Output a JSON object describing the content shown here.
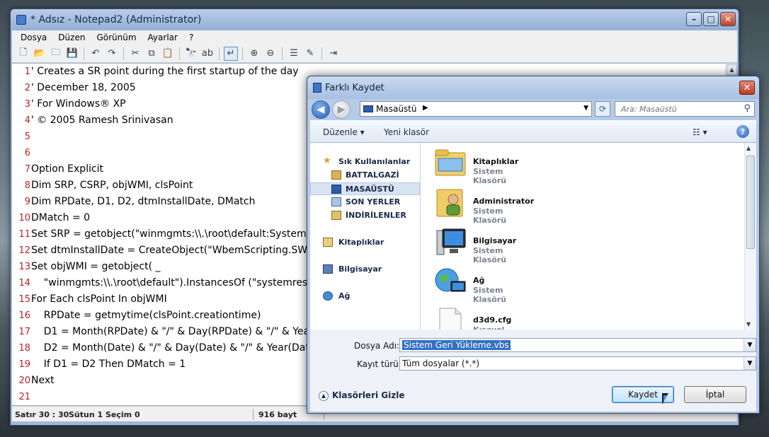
{
  "notepad": {
    "title": "* Adsız - Notepad2 (Administrator)",
    "menu": [
      "Dosya",
      "Düzen",
      "Görünüm",
      "Ayarlar",
      "?"
    ],
    "lines": [
      {
        "n": "1",
        "text": "' Creates a SR point during the first startup of the day"
      },
      {
        "n": "2",
        "text": "' December 18, 2005"
      },
      {
        "n": "3",
        "text": "' For Windows® XP"
      },
      {
        "n": "4",
        "text": "' © 2005 Ramesh Srinivasan"
      },
      {
        "n": "5",
        "text": ""
      },
      {
        "n": "6",
        "text": ""
      },
      {
        "n": "7",
        "text": "Option Explicit"
      },
      {
        "n": "8",
        "text": "Dim SRP, CSRP, objWMI, clsPoint"
      },
      {
        "n": "9",
        "text": "Dim RPDate, D1, D2, dtmInstallDate, DMatch"
      },
      {
        "n": "10",
        "text": "DMatch = 0"
      },
      {
        "n": "11",
        "text": "Set SRP = getobject(\"winmgmts:\\\\.\\root\\default:Systemre"
      },
      {
        "n": "12",
        "text": "Set dtmInstallDate = CreateObject(\"WbemScripting.SWbe"
      },
      {
        "n": "13",
        "text": "Set objWMI = getobject( _"
      },
      {
        "n": "14",
        "text": "    \"winmgmts:\\\\.\\root\\default\").InstancesOf (\"systemresto"
      },
      {
        "n": "15",
        "text": "For Each clsPoint In objWMI"
      },
      {
        "n": "16",
        "text": "    RPDate = getmytime(clsPoint.creationtime)"
      },
      {
        "n": "17",
        "text": "    D1 = Month(RPDate) & \"/\" & Day(RPDate) & \"/\" & Yea"
      },
      {
        "n": "18",
        "text": "    D2 = Month(Date) & \"/\" & Day(Date) & \"/\" & Year(Dat"
      },
      {
        "n": "19",
        "text": "    If D1 = D2 Then DMatch = 1"
      },
      {
        "n": "20",
        "text": "Next"
      },
      {
        "n": "21",
        "text": ""
      }
    ],
    "status": {
      "line": "Satır 30 : 30",
      "column": "Sütun 1",
      "selection": "Seçim 0",
      "size": "916 bayt"
    }
  },
  "dialog": {
    "title": "Farklı Kaydet",
    "address": "Masaüstü",
    "search_placeholder": "Ara: Masaüstü",
    "organize": "Düzenle",
    "new_folder": "Yeni klasör",
    "nav": [
      {
        "label": "Sık Kullanılanlar",
        "icon": "star-icon"
      },
      {
        "label": "BATTALGAZİ",
        "icon": "user-folder-icon"
      },
      {
        "label": "MASAÜSTÜ",
        "icon": "desktop-icon"
      },
      {
        "label": "SON YERLER",
        "icon": "recent-places-icon"
      },
      {
        "label": "İNDİRİLENLER",
        "icon": "downloads-icon"
      },
      {
        "label": "Kitaplıklar",
        "icon": "libraries-icon"
      },
      {
        "label": "Bilgisayar",
        "icon": "computer-icon"
      },
      {
        "label": "Ağ",
        "icon": "network-icon"
      }
    ],
    "files": [
      {
        "name": "Kitaplıklar",
        "type": "Sistem Klasörü",
        "icon": "libraries-folder-icon"
      },
      {
        "name": "Administrator",
        "type": "Sistem Klasörü",
        "icon": "user-folder-icon"
      },
      {
        "name": "Bilgisayar",
        "type": "Sistem Klasörü",
        "icon": "computer-icon"
      },
      {
        "name": "Ağ",
        "type": "Sistem Klasörü",
        "icon": "network-globe-icon"
      },
      {
        "name": "d3d9.cfg",
        "type": "Kısayol",
        "icon": "file-shortcut-icon"
      }
    ],
    "filename_label": "Dosya Adı:",
    "filename_value": "Sistem Geri Yükleme.vbs",
    "filetype_label": "Kayıt türü:",
    "filetype_value": "Tüm dosyalar (*.*)",
    "hide_folders": "Klasörleri Gizle",
    "save": "Kaydet",
    "cancel": "İptal"
  },
  "colors": {
    "line_number": "#c02020",
    "selection": "#3470c4"
  }
}
